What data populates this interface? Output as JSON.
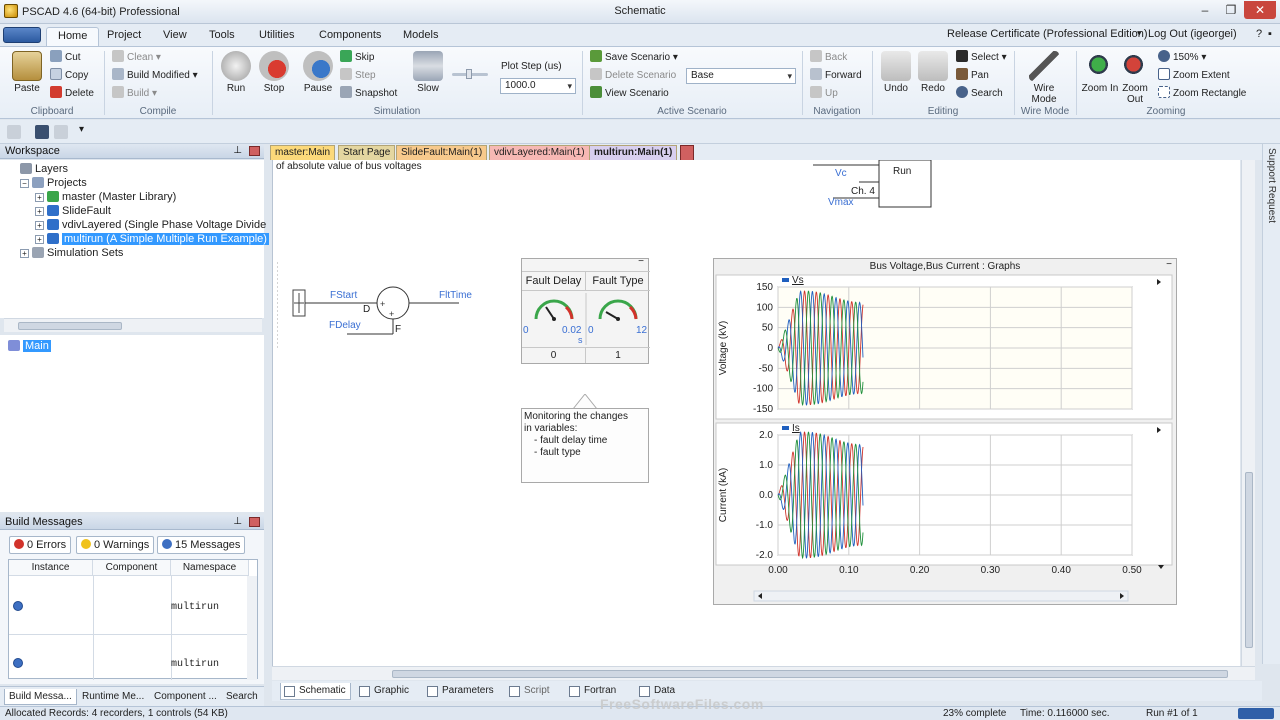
{
  "window": {
    "app_title": "PSCAD 4.6 (64-bit) Professional",
    "doc_title": "Schematic"
  },
  "menu": {
    "tabs": [
      "Home",
      "Project",
      "View",
      "Tools",
      "Utilities",
      "Components",
      "Models"
    ],
    "active": "Home",
    "certificate": "Release Certificate (Professional Edition)",
    "logout": "Log Out (igeorgei)"
  },
  "ribbon": {
    "clipboard": {
      "paste": "Paste",
      "cut": "Cut",
      "copy": "Copy",
      "delete": "Delete",
      "label": "Clipboard"
    },
    "compile": {
      "clean": "Clean",
      "build_modified": "Build Modified",
      "build": "Build",
      "label": "Compile"
    },
    "simulation": {
      "run": "Run",
      "stop": "Stop",
      "pause": "Pause",
      "skip": "Skip",
      "step": "Step",
      "snapshot": "Snapshot",
      "slow": "Slow",
      "plot_step_label": "Plot Step (us)",
      "plot_step_value": "1000.0",
      "label": "Simulation"
    },
    "scenario": {
      "save": "Save Scenario",
      "delete": "Delete Scenario",
      "view": "View Scenario",
      "value": "Base",
      "label": "Active Scenario"
    },
    "navigation": {
      "back": "Back",
      "forward": "Forward",
      "up": "Up",
      "label": "Navigation"
    },
    "editing": {
      "undo": "Undo",
      "redo": "Redo",
      "select": "Select",
      "pan": "Pan",
      "search": "Search",
      "label": "Editing"
    },
    "wire": {
      "wire_mode": "Wire Mode",
      "label": "Wire Mode"
    },
    "zoom": {
      "zoom_in": "Zoom In",
      "zoom_out": "Zoom Out",
      "level": "150%",
      "extent": "Zoom Extent",
      "rectangle": "Zoom Rectangle",
      "label": "Zooming"
    }
  },
  "workspace": {
    "title": "Workspace",
    "layers": "Layers",
    "projects": "Projects",
    "items": [
      "master (Master Library)",
      "SlideFault",
      "vdivLayered (Single Phase Voltage Divide",
      "multirun (A Simple Multiple Run Example)"
    ],
    "simulation_sets": "Simulation Sets",
    "main_node": "Main"
  },
  "build_messages": {
    "title": "Build Messages",
    "errors": "0 Errors",
    "warnings": "0 Warnings",
    "messages": "15 Messages",
    "columns": [
      "Instance",
      "Component",
      "Namespace"
    ],
    "rows": [
      {
        "namespace": "multirun"
      },
      {
        "namespace": "multirun"
      }
    ]
  },
  "panel_tabs": [
    "Build Messa...",
    "Runtime Me...",
    "Component ...",
    "Search"
  ],
  "doc_tabs": [
    "master:Main",
    "Start Page",
    "SlideFault:Main(1)",
    "vdivLayered:Main(1)",
    "multirun:Main(1)"
  ],
  "canvas": {
    "top_text": "of absolute value of bus voltages",
    "multirun_block": "Run",
    "ch_label": "Ch. 4",
    "vc": "Vc",
    "vmax": "Vmax",
    "fstart": "FStart",
    "fdelay": "FDelay",
    "flttime": "FltTime",
    "d": "D",
    "f": "F",
    "meter": {
      "fault_delay": "Fault Delay",
      "fault_type": "Fault Type",
      "fd_min": "0",
      "fd_max": "0.02",
      "fd_unit": "s",
      "ft_min": "0",
      "ft_max": "12",
      "fd_value": "0",
      "ft_value": "1"
    },
    "note": {
      "line1": "Monitoring the changes",
      "line2": "in variables:",
      "line3": "- fault delay time",
      "line4": "- fault type"
    }
  },
  "chart_data": [
    {
      "type": "line",
      "title": "Bus Voltage,Bus Current : Graphs",
      "series": [
        {
          "name": "Vs"
        }
      ],
      "ylabel": "Voltage (kV)",
      "ylim": [
        -150,
        150
      ],
      "yticks": [
        150,
        100,
        50,
        0,
        -50,
        -100,
        -150
      ],
      "xlim": [
        0,
        0.5
      ],
      "note": "oscillating three-phase signal from 0 to ~0.12 s with growing amplitude up to ~140 kV"
    },
    {
      "type": "line",
      "series": [
        {
          "name": "Is"
        }
      ],
      "ylabel": "Current (kA)",
      "ylim": [
        -2.0,
        2.0
      ],
      "yticks": [
        2.0,
        1.0,
        0.0,
        -1.0,
        -2.0
      ],
      "xticks": [
        0.0,
        0.1,
        0.2,
        0.3,
        0.4,
        0.5
      ],
      "xlim": [
        0,
        0.5
      ]
    }
  ],
  "chart_labels": {
    "yticks_v": [
      "150",
      "100",
      "50",
      "0",
      "-50",
      "-100",
      "-150"
    ],
    "yticks_i": [
      "2.0",
      "1.0",
      "0.0",
      "-1.0",
      "-2.0"
    ],
    "xticks": [
      "0.00",
      "0.10",
      "0.20",
      "0.30",
      "0.40",
      "0.50"
    ]
  },
  "canvas_tabs": [
    "Schematic",
    "Graphic",
    "Parameters",
    "Script",
    "Fortran",
    "Data"
  ],
  "status": {
    "records": "Allocated Records: 4 recorders, 1 controls (54 KB)",
    "complete": "23% complete",
    "time": "Time: 0.116000 sec.",
    "run": "Run #1 of 1"
  },
  "support_request": "Support Request",
  "watermark": "FreeSoftwareFiles.com",
  "colors": {
    "accent": "#3399ff",
    "phase_a": "#d0342c",
    "phase_b": "#1f5fbf",
    "phase_c": "#1f8f3a"
  }
}
